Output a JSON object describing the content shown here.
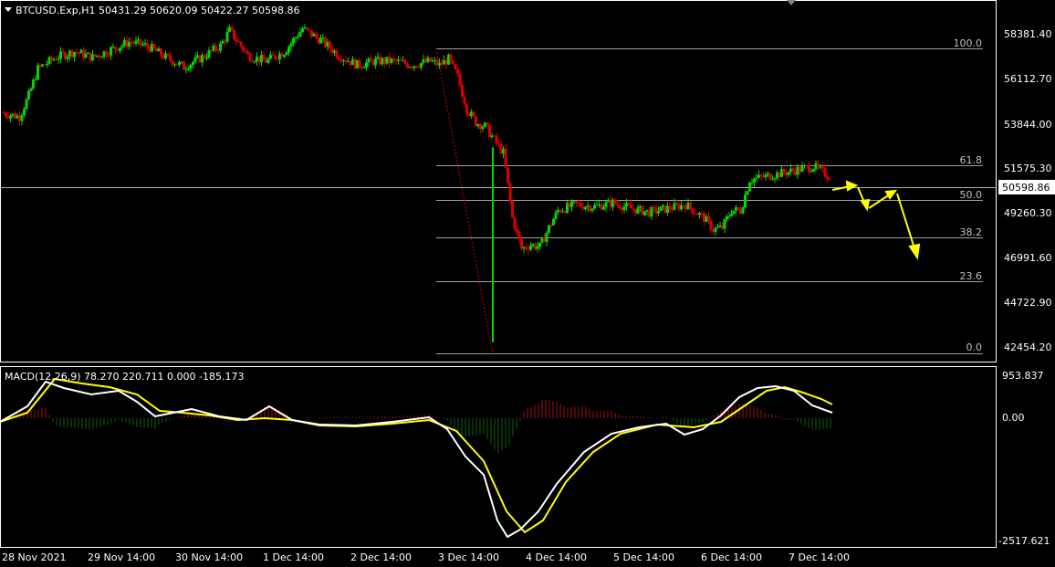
{
  "header": {
    "symbol_line": "BTCUSD.Exp,H1  50431.29 50620.09 50422.27 50598.86"
  },
  "price_axis": {
    "ticks": [
      "58381.40",
      "56112.70",
      "53844.00",
      "51575.30",
      "49260.30",
      "46991.60",
      "44722.90",
      "42454.20"
    ],
    "current_price": "50598.86"
  },
  "macd_panel": {
    "label": "MACD(12,26,9) 78.270 220.711 0.000 -185.173",
    "ticks": [
      "953.837",
      "0.00",
      "-2517.621"
    ]
  },
  "time_axis": {
    "labels": [
      "28 Nov 2021",
      "29 Nov 14:00",
      "30 Nov 14:00",
      "1 Dec 14:00",
      "2 Dec 14:00",
      "3 Dec 14:00",
      "4 Dec 14:00",
      "5 Dec 14:00",
      "6 Dec 14:00",
      "7 Dec 14:00"
    ]
  },
  "fibonacci": {
    "levels": [
      "100.0",
      "61.8",
      "50.0",
      "38.2",
      "23.6",
      "0.0"
    ]
  },
  "chart_data": {
    "type": "line",
    "title": "BTCUSD.Exp,H1",
    "timeframe": "H1",
    "last_bar": {
      "open": 50431.29,
      "high": 50620.09,
      "low": 50422.27,
      "close": 50598.86
    },
    "ylim": [
      41300,
      60100
    ],
    "x": [
      "28 Nov 2021",
      "29 Nov 14:00",
      "30 Nov 14:00",
      "1 Dec 14:00",
      "2 Dec 14:00",
      "3 Dec 14:00",
      "4 Dec 14:00",
      "5 Dec 14:00",
      "6 Dec 14:00",
      "7 Dec 14:00"
    ],
    "price_path": [
      [
        0,
        54300
      ],
      [
        2,
        54100
      ],
      [
        3,
        55200
      ],
      [
        4,
        56600
      ],
      [
        6,
        57200
      ],
      [
        8,
        57500
      ],
      [
        10,
        57200
      ],
      [
        12,
        57600
      ],
      [
        14,
        58000
      ],
      [
        16,
        57800
      ],
      [
        18,
        57200
      ],
      [
        20,
        56700
      ],
      [
        22,
        57200
      ],
      [
        24,
        57800
      ],
      [
        25,
        58600
      ],
      [
        27,
        57300
      ],
      [
        29,
        57000
      ],
      [
        31,
        57500
      ],
      [
        33,
        58700
      ],
      [
        35,
        58100
      ],
      [
        37,
        57300
      ],
      [
        39,
        56800
      ],
      [
        41,
        57000
      ],
      [
        43,
        57000
      ],
      [
        45,
        56800
      ],
      [
        47,
        57000
      ],
      [
        48,
        56800
      ],
      [
        49,
        57100
      ],
      [
        50,
        56200
      ],
      [
        51,
        54500
      ],
      [
        52,
        53800
      ],
      [
        53,
        53600
      ],
      [
        54,
        52900
      ],
      [
        55,
        52200
      ],
      [
        56,
        48800
      ],
      [
        57,
        47200
      ],
      [
        58,
        47400
      ],
      [
        59,
        47300
      ],
      [
        60,
        48300
      ],
      [
        61,
        49200
      ],
      [
        63,
        49500
      ],
      [
        65,
        49400
      ],
      [
        67,
        49600
      ],
      [
        69,
        49300
      ],
      [
        71,
        49100
      ],
      [
        73,
        49300
      ],
      [
        75,
        49500
      ],
      [
        77,
        48800
      ],
      [
        78,
        48200
      ],
      [
        79,
        48300
      ],
      [
        80,
        49200
      ],
      [
        81,
        49200
      ],
      [
        82,
        50800
      ],
      [
        84,
        51000
      ],
      [
        86,
        51200
      ],
      [
        88,
        51400
      ],
      [
        89,
        51500
      ],
      [
        90,
        51200
      ],
      [
        91,
        50900
      ],
      [
        92,
        50600
      ]
    ],
    "fibonacci_swing": {
      "high": 57400,
      "low": 42300,
      "levels": [
        100.0,
        61.8,
        50.0,
        38.2,
        23.6,
        0.0
      ]
    },
    "projection_arrows": [
      [
        50600,
        50800
      ],
      [
        50800,
        49900
      ],
      [
        49900,
        50400
      ],
      [
        50400,
        47000
      ]
    ],
    "macd": {
      "params": "12,26,9",
      "values": [
        78.27,
        220.711,
        0.0,
        -185.173
      ],
      "ylim": [
        -2517.621,
        953.837
      ],
      "series": [
        {
          "name": "MACD",
          "color": "#ffffff"
        },
        {
          "name": "Signal",
          "color": "#ffff00"
        }
      ]
    }
  },
  "colors": {
    "up": "#00d800",
    "down": "#d80000",
    "grid_line": "#ffffff",
    "fib_line": "#c0c0c0",
    "arrows": "#ffff00",
    "macd_line": "#ffffff",
    "signal_line": "#ffff00"
  }
}
